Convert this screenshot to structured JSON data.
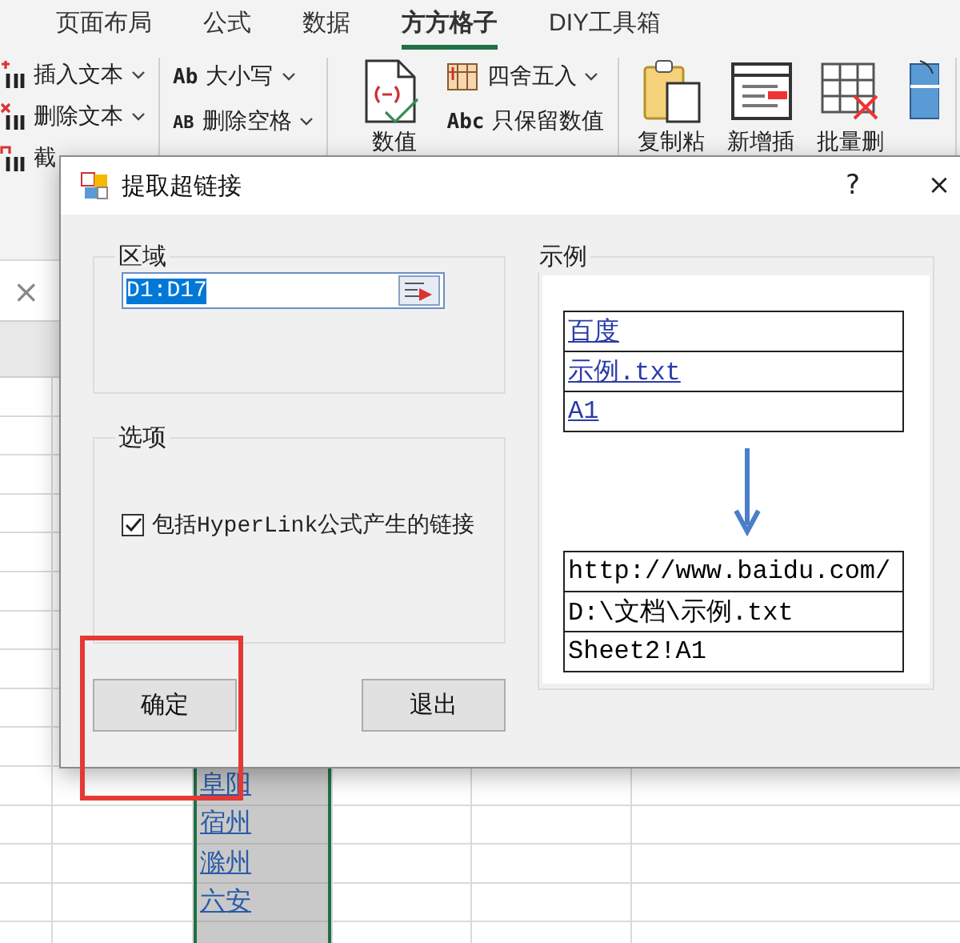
{
  "ribbon": {
    "tabs": [
      {
        "label": "页面布局",
        "selected": false
      },
      {
        "label": "公式",
        "selected": false
      },
      {
        "label": "数据",
        "selected": false
      },
      {
        "label": "方方格子",
        "selected": true
      },
      {
        "label": "DIY工具箱",
        "selected": false
      }
    ],
    "groups": [
      {
        "items": [
          {
            "kind": "small",
            "label": "插入文本",
            "dropdown": true
          },
          {
            "kind": "small",
            "label": "删除文本",
            "dropdown": true
          },
          {
            "kind": "small",
            "label": "截"
          }
        ]
      },
      {
        "items": [
          {
            "kind": "small",
            "glyph": "Ab",
            "label": "大小写",
            "dropdown": true
          },
          {
            "kind": "small",
            "glyph": "AB",
            "label": "删除空格",
            "dropdown": true
          }
        ]
      },
      {
        "items": [
          {
            "kind": "large",
            "label": "数值"
          },
          {
            "kind": "small",
            "label": "四舍五入",
            "dropdown": true
          },
          {
            "kind": "small",
            "glyph": "Abc",
            "label": "只保留数值",
            "dropdown": false
          }
        ]
      },
      {
        "items": [
          {
            "kind": "large",
            "label": "复制粘"
          },
          {
            "kind": "large",
            "label": "新增插"
          },
          {
            "kind": "large",
            "label": "批量删"
          },
          {
            "kind": "large"
          }
        ]
      }
    ]
  },
  "sheet": {
    "name_box_close": "×",
    "links": [
      "阜阳",
      "宿州",
      "滁州",
      "六安"
    ]
  },
  "dialog": {
    "title": "提取超链接",
    "help": "?",
    "close": "×",
    "region": {
      "label": "区域",
      "value": "D1:D17"
    },
    "options": {
      "label": "选项",
      "checkbox": {
        "label": "包括HyperLink公式产生的链接",
        "checked": true
      }
    },
    "example": {
      "label": "示例",
      "links": [
        "百度",
        "示例.txt",
        "A1"
      ],
      "results": [
        "http://www.baidu.com/",
        "D:\\文档\\示例.txt",
        "Sheet2!A1"
      ]
    },
    "buttons": [
      {
        "label": "确定"
      },
      {
        "label": "退出"
      }
    ]
  }
}
